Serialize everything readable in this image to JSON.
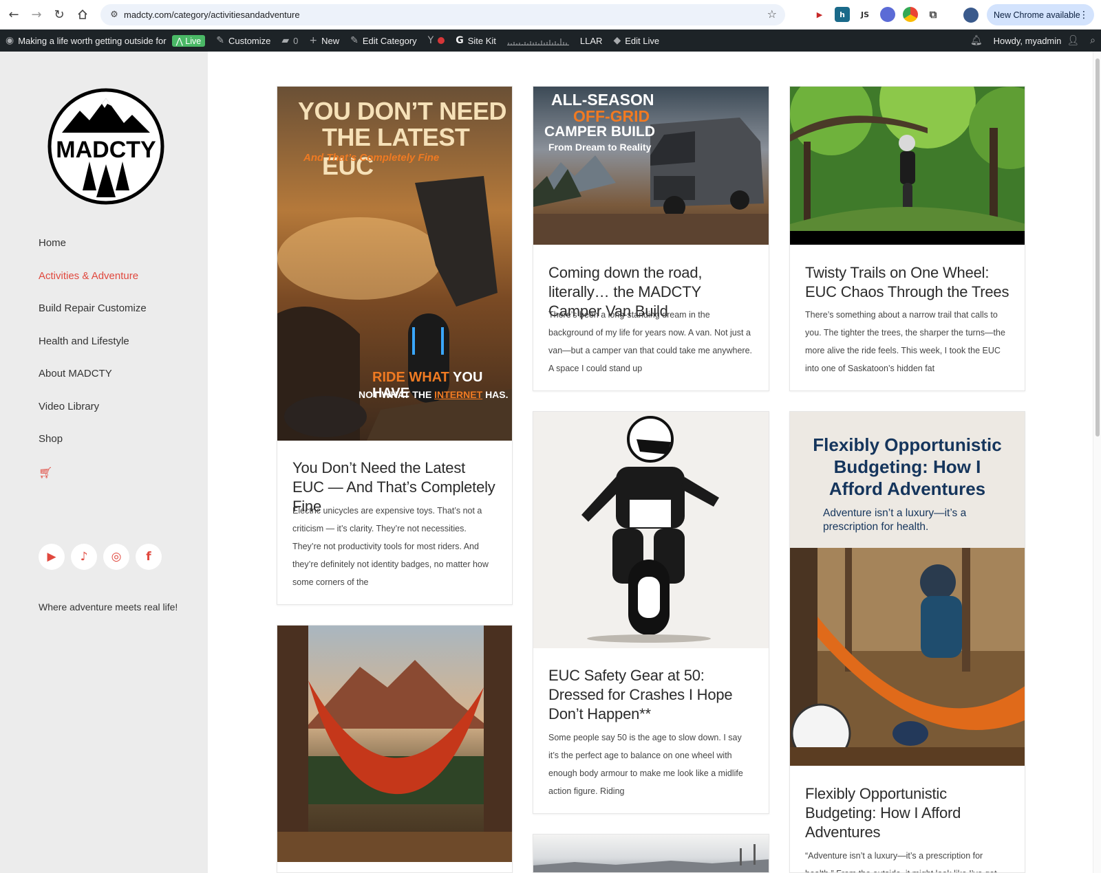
{
  "browser": {
    "url": "madcty.com/category/activitiesandadventure",
    "extensions": [
      "JS"
    ],
    "new_chrome_label": "New Chrome available"
  },
  "admin_bar": {
    "site_name": "Making a life worth getting outside for",
    "live_badge": "Live",
    "customize": "Customize",
    "comments_count": "0",
    "new": "New",
    "edit_category": "Edit Category",
    "site_kit": "Site Kit",
    "llar": "LLAR",
    "edit_live": "Edit Live",
    "howdy": "Howdy, myadmin"
  },
  "sidebar": {
    "logo_text": "MADCTY",
    "menu": [
      {
        "label": "Home",
        "active": false
      },
      {
        "label": "Activities & Adventure",
        "active": true
      },
      {
        "label": "Build Repair Customize",
        "active": false
      },
      {
        "label": "Health and Lifestyle",
        "active": false
      },
      {
        "label": "About MADCTY",
        "active": false
      },
      {
        "label": "Video Library",
        "active": false
      },
      {
        "label": "Shop",
        "active": false
      }
    ],
    "tagline": "Where adventure meets real life!",
    "accent_color": "#e0483e"
  },
  "posts": [
    {
      "title": "You Don’t Need the Latest EUC — And That’s Completely Fine",
      "excerpt": "Electric unicycles are expensive toys. That’s not a criticism — it’s clarity. They’re not necessities. They’re not productivity tools for most riders. And they’re definitely not identity badges, no matter how some corners of the",
      "image_text": {
        "line1": "You Don’t Need",
        "line2": "the Latest EUC",
        "line3": "And That’s Completely Fine",
        "footer1a": "RIDE WHAT",
        "footer1b": "YOU HAVE",
        "footer2a": "NOT WHAT THE",
        "footer2b": "INTERNET",
        "footer2c": "HAS."
      }
    },
    {
      "title": "Coming down the road, literally… the MADCTY Camper Van Build",
      "excerpt": "There’s been a long-standing dream in the background of my life for years now. A van. Not just a van—but a camper van that could take me anywhere. A space I could stand up",
      "image_text": {
        "line1": "ALL-SEASON",
        "line2": "OFF-GRID",
        "line3": "CAMPER BUILD",
        "line4": "From Dream to Reality"
      }
    },
    {
      "title": "Twisty Trails on One Wheel: EUC Chaos Through the Trees",
      "excerpt": "There’s something about a narrow trail that calls to you. The tighter the trees, the sharper the turns—the more alive the ride feels. This week, I took the EUC into one of Saskatoon’s hidden fat"
    },
    {
      "title": "EUC Safety Gear at 50: Dressed for Crashes I Hope Don’t Happen**",
      "excerpt": "Some people say 50 is the age to slow down. I say it’s the perfect age to balance on one wheel with enough body armour to make me look like a midlife action figure. Riding"
    },
    {
      "title": "Flexibly Opportunistic Budgeting: How I Afford Adventures",
      "excerpt": "“Adventure isn’t a luxury—it’s a prescription for health.” From the outside, it might look like I’ve got",
      "image_text": {
        "headline": "Flexibly Opportunistic Budgeting: How I Afford Adventures",
        "sub": "Adventure isn’t a luxury—it’s a prescription for health."
      }
    }
  ]
}
